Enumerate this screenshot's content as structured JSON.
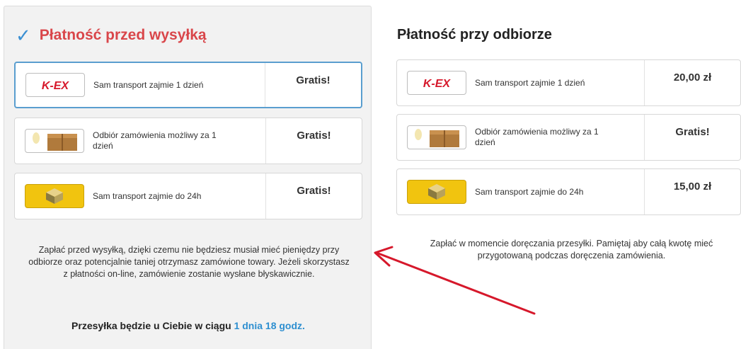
{
  "prepaid": {
    "title": "Płatność przed wysyłką",
    "options": [
      {
        "logo": "K-EX",
        "desc": "Sam transport zajmie 1 dzień",
        "price": "Gratis!"
      },
      {
        "logo": "pickup-point",
        "desc": "Odbiór zamówienia możliwy za 1 dzień",
        "price": "Gratis!"
      },
      {
        "logo": "courier-box",
        "desc": "Sam transport zajmie do 24h",
        "price": "Gratis!"
      }
    ],
    "note": "Zapłać przed wysyłką, dzięki czemu nie będziesz musiał mieć pieniędzy przy odbiorze oraz potencjalnie taniej otrzymasz zamówione towary. Jeżeli skorzystasz z płatności on-line, zamówienie zostanie wysłane błyskawicznie.",
    "delivery_prefix": "Przesyłka będzie u Ciebie w ciągu ",
    "delivery_time": "1 dnia 18 godz."
  },
  "cod": {
    "title": "Płatność przy odbiorze",
    "options": [
      {
        "logo": "K-EX",
        "desc": "Sam transport zajmie 1 dzień",
        "price": "20,00 zł"
      },
      {
        "logo": "pickup-point",
        "desc": "Odbiór zamówienia możliwy za 1 dzień",
        "price": "Gratis!"
      },
      {
        "logo": "courier-box",
        "desc": "Sam transport zajmie do 24h",
        "price": "15,00 zł"
      }
    ],
    "note": "Zapłać w momencie doręczania przesyłki. Pamiętaj aby całą kwotę mieć przygotowaną podczas doręczenia zamówienia."
  },
  "colors": {
    "accent_red": "#d9464a",
    "accent_blue": "#3a8fd2",
    "arrow_red": "#d6182b"
  }
}
